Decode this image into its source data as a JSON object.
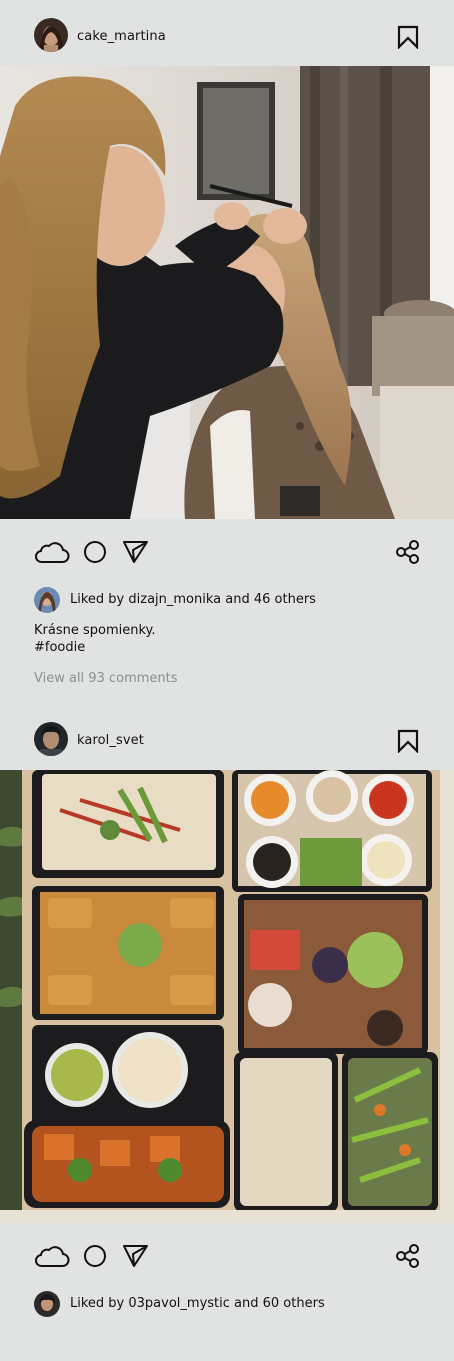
{
  "posts": [
    {
      "username": "cake_martina",
      "liked_by_prefix": "Liked by",
      "liked_by_user": "dizajn_monika",
      "liked_by_suffix": "and 46 others",
      "caption_line1": "Krásne spomienky.",
      "caption_line2": "#foodie",
      "view_comments": "View all 93 comments",
      "photo_subject": "makeup artist applying eyebrow pencil to a woman"
    },
    {
      "username": "karol_svet",
      "liked_by_prefix": "Liked by",
      "liked_by_user": "03pavol_mystic",
      "liked_by_suffix": "and 60 others",
      "photo_subject": "takeout box with rice, fried food, salads and sauces"
    }
  ],
  "icons": [
    "avatar",
    "bookmark-icon",
    "like-cloud-icon",
    "comment-circle-icon",
    "send-icon",
    "share-icon"
  ],
  "colors": {
    "background": "#e1e3e3",
    "text": "#111111",
    "muted": "#8d8f8f"
  }
}
